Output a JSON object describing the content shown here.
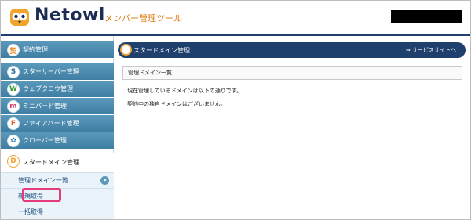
{
  "header": {
    "logo_text": "Netowl",
    "subtitle": "メンバー管理ツール"
  },
  "sidebar": {
    "items": [
      {
        "label": "契約管理",
        "icon": "contract-icon"
      },
      {
        "label": "スターサーバー管理",
        "icon": "star-server-icon"
      },
      {
        "label": "ウェブクロウ管理",
        "icon": "webcrow-icon"
      },
      {
        "label": "ミニバード管理",
        "icon": "minibird-icon"
      },
      {
        "label": "ファイアバード管理",
        "icon": "firebird-icon"
      },
      {
        "label": "クローバー管理",
        "icon": "clover-icon"
      },
      {
        "label": "スタードメイン管理",
        "icon": "stardomain-icon"
      }
    ],
    "sub_items": [
      {
        "label": "管理ドメイン一覧"
      },
      {
        "label": "新規取得"
      },
      {
        "label": "一括取得"
      }
    ]
  },
  "main": {
    "title": "スタードメイン管理",
    "link": "⇒ サービスサイトへ",
    "section_title": "管理ドメイン一覧",
    "lines": [
      "現在管理しているドメインは以下の通りです。",
      "契約中の独自ドメインはございません。"
    ]
  },
  "colors": {
    "navy": "#1f3f6c",
    "sidebar_blue": "#4a88ad",
    "highlight": "#e43c7a",
    "accent_orange": "#e07c10"
  }
}
